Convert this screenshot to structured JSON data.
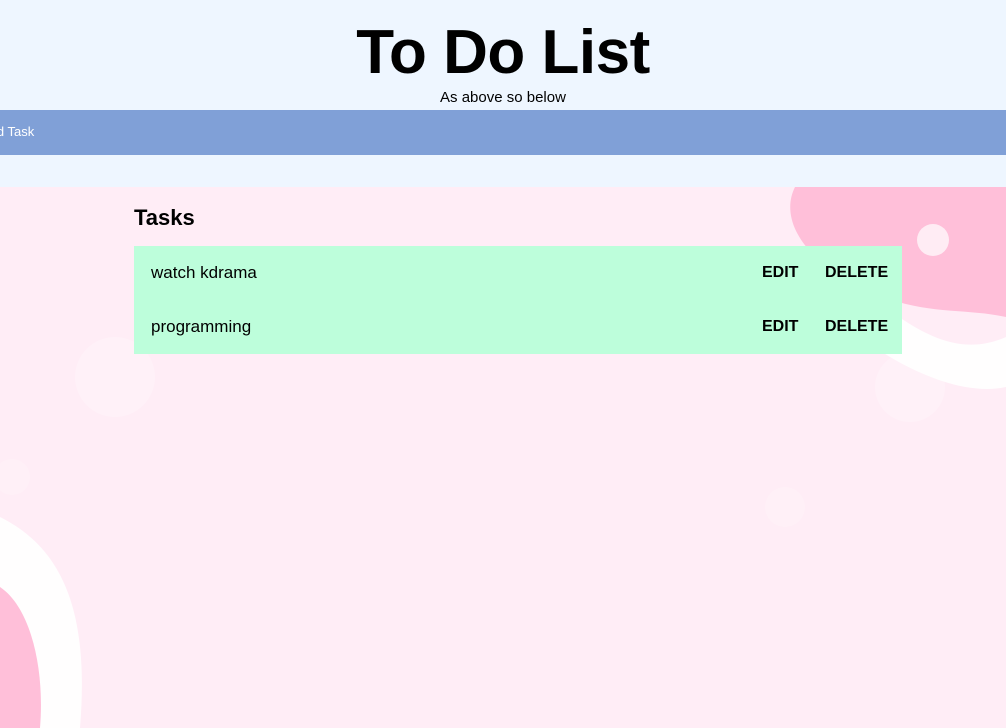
{
  "header": {
    "title": "To Do List",
    "subtitle": "As above so below"
  },
  "nav": {
    "items": [
      {
        "label": "Add Task"
      }
    ]
  },
  "main": {
    "heading": "Tasks",
    "tasks": [
      {
        "name": "watch kdrama",
        "edit_label": "EDIT",
        "delete_label": "DELETE"
      },
      {
        "name": "programming",
        "edit_label": "EDIT",
        "delete_label": "DELETE"
      }
    ]
  },
  "colors": {
    "header_bg": "#eef6ff",
    "nav_bg": "#80a0d7",
    "content_bg": "#ffedf6",
    "task_bg": "#bdfedb",
    "blob_pink": "#ffbfd9"
  }
}
